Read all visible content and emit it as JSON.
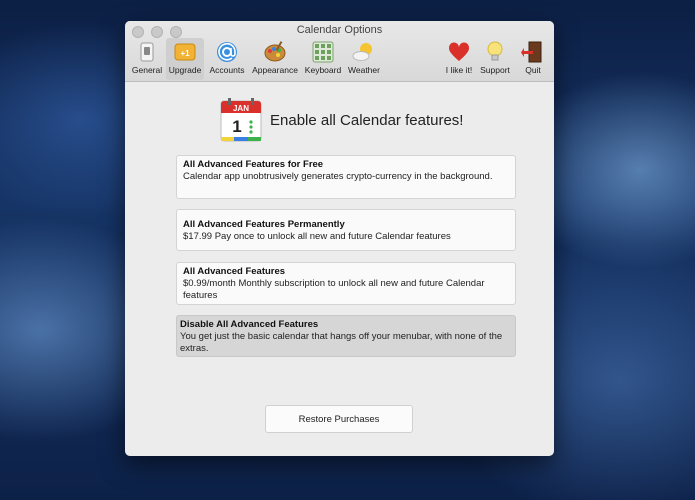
{
  "window": {
    "title": "Calendar Options"
  },
  "toolbar": {
    "items": [
      {
        "label": "General",
        "icon": "switch-icon"
      },
      {
        "label": "Upgrade",
        "icon": "upgrade-icon"
      },
      {
        "label": "Accounts",
        "icon": "at-sign-icon"
      },
      {
        "label": "Appearance",
        "icon": "palette-icon"
      },
      {
        "label": "Keyboard",
        "icon": "keyboard-icon"
      },
      {
        "label": "Weather",
        "icon": "weather-icon"
      },
      {
        "label": "I like it!",
        "icon": "heart-icon"
      },
      {
        "label": "Support",
        "icon": "lightbulb-icon"
      },
      {
        "label": "Quit",
        "icon": "exit-door-icon"
      }
    ],
    "active": "Upgrade"
  },
  "header": {
    "title": "Enable all Calendar features!",
    "calendar_month": "JAN",
    "calendar_day": "1"
  },
  "options": [
    {
      "title": "All Advanced Features for Free",
      "desc": "Calendar app unobtrusively generates crypto-currency in the background."
    },
    {
      "title": "All Advanced Features Permanently",
      "desc": "$17.99 Pay once to unlock all new and future Calendar features"
    },
    {
      "title": "All Advanced Features",
      "desc": "$0.99/month Monthly subscription to unlock all new and future Calendar features"
    },
    {
      "title": "Disable All Advanced Features",
      "desc": "You get just the basic calendar that hangs off your menubar, with none of the extras."
    }
  ],
  "restore_label": "Restore Purchases",
  "colors": {
    "accent": "#d9302c",
    "window_bg": "#ececec",
    "selected_bg": "#d6d6d6"
  }
}
